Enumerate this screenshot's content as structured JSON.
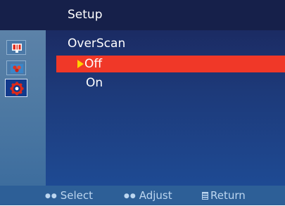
{
  "header": {
    "title": "Setup"
  },
  "sidebar": {
    "items": [
      {
        "icon": "picture-icon",
        "active": false
      },
      {
        "icon": "color-icon",
        "active": false
      },
      {
        "icon": "setup-gear-icon",
        "active": true
      }
    ]
  },
  "menu": {
    "label": "OverScan",
    "options": [
      {
        "label": "Off",
        "selected": true
      },
      {
        "label": "On",
        "selected": false
      }
    ]
  },
  "footer": {
    "select_label": "Select",
    "adjust_label": "Adjust",
    "return_label": "Return"
  },
  "colors": {
    "highlight": "#f03828",
    "arrow": "#ffd200",
    "panel": "#1d3a7a",
    "sidebar": "#4f7aa3",
    "footer": "#2d5f97"
  }
}
